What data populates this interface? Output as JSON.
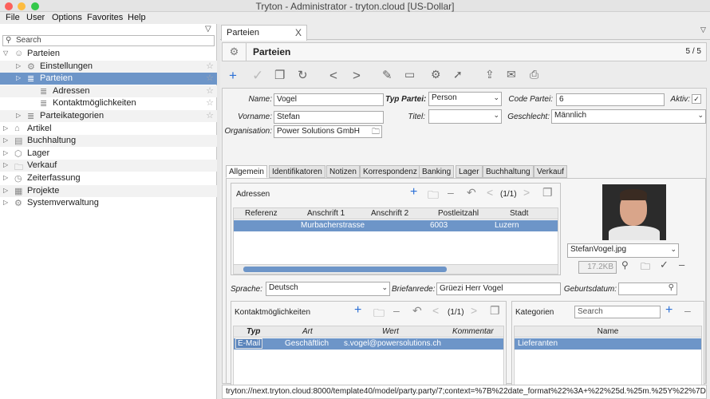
{
  "window": {
    "title": "Tryton - Administrator - tryton.cloud [US-Dollar]"
  },
  "menubar": [
    "File",
    "User",
    "Options",
    "Favorites",
    "Help"
  ],
  "search": {
    "placeholder": "Search"
  },
  "tree": [
    {
      "label": "Parteien",
      "level": 0,
      "icon": "user-icon",
      "expanded": true
    },
    {
      "label": "Einstellungen",
      "level": 1,
      "icon": "gear-icon"
    },
    {
      "label": "Parteien",
      "level": 1,
      "icon": "list-icon",
      "selected": true
    },
    {
      "label": "Adressen",
      "level": 2,
      "icon": "list-icon"
    },
    {
      "label": "Kontaktmöglichkeiten",
      "level": 2,
      "icon": "list-icon"
    },
    {
      "label": "Parteikategorien",
      "level": 1,
      "icon": "list-icon"
    },
    {
      "label": "Artikel",
      "level": 0,
      "icon": "tag-icon"
    },
    {
      "label": "Buchhaltung",
      "level": 0,
      "icon": "accounting-icon"
    },
    {
      "label": "Lager",
      "level": 0,
      "icon": "box-icon"
    },
    {
      "label": "Verkauf",
      "level": 0,
      "icon": "folder-icon"
    },
    {
      "label": "Zeiterfassung",
      "level": 0,
      "icon": "clock-icon"
    },
    {
      "label": "Projekte",
      "level": 0,
      "icon": "project-icon"
    },
    {
      "label": "Systemverwaltung",
      "level": 0,
      "icon": "gear-icon"
    }
  ],
  "tab": {
    "label": "Parteien",
    "close": "X"
  },
  "header": {
    "title": "Parteien",
    "count": "5 / 5"
  },
  "form": {
    "name_label": "Name:",
    "name_value": "Vogel",
    "typ_label": "Typ Partei:",
    "typ_value": "Person",
    "code_label": "Code Partei:",
    "code_value": "6",
    "aktiv_label": "Aktiv:",
    "aktiv_mark": "✓",
    "vorname_label": "Vorname:",
    "vorname_value": "Stefan",
    "titel_label": "Titel:",
    "titel_value": "",
    "geschlecht_label": "Geschlecht:",
    "geschlecht_value": "Männlich",
    "org_label": "Organisation:",
    "org_value": "Power Solutions GmbH",
    "sprache_label": "Sprache:",
    "sprache_value": "Deutsch",
    "brief_label": "Briefanrede:",
    "brief_value": "Grüezi Herr Vogel",
    "geburt_label": "Geburtsdatum:",
    "geburt_value": ""
  },
  "notebook_tabs": [
    "Allgemein",
    "Identifikatoren",
    "Notizen",
    "Korrespondenz",
    "Banking",
    "Lager",
    "Buchhaltung",
    "Verkauf"
  ],
  "adressen": {
    "title": "Adressen",
    "pager": "(1/1)",
    "columns": [
      "Referenz",
      "Anschrift 1",
      "Anschrift 2",
      "Postleitzahl",
      "Stadt"
    ],
    "rows": [
      [
        "",
        "Murbacherstrasse",
        "",
        "6003",
        "Luzern"
      ]
    ]
  },
  "photo": {
    "filename": "StefanVogel.jpg",
    "size": "17.2KB"
  },
  "kontakt": {
    "title": "Kontaktmöglichkeiten",
    "pager": "(1/1)",
    "columns": [
      "Typ",
      "Art",
      "Wert",
      "Kommentar"
    ],
    "rows": [
      [
        "E-Mail",
        "Geschäftlich",
        "s.vogel@powersolutions.ch",
        ""
      ]
    ]
  },
  "kategorien": {
    "title": "Kategorien",
    "search_placeholder": "Search",
    "column": "Name",
    "rows": [
      "Lieferanten"
    ]
  },
  "status": "tryton://next.tryton.cloud:8000/template40/model/party.party/7;context=%7B%22date_format%22%3A+%22%25d.%25m.%25Y%22%7D&vie"
}
